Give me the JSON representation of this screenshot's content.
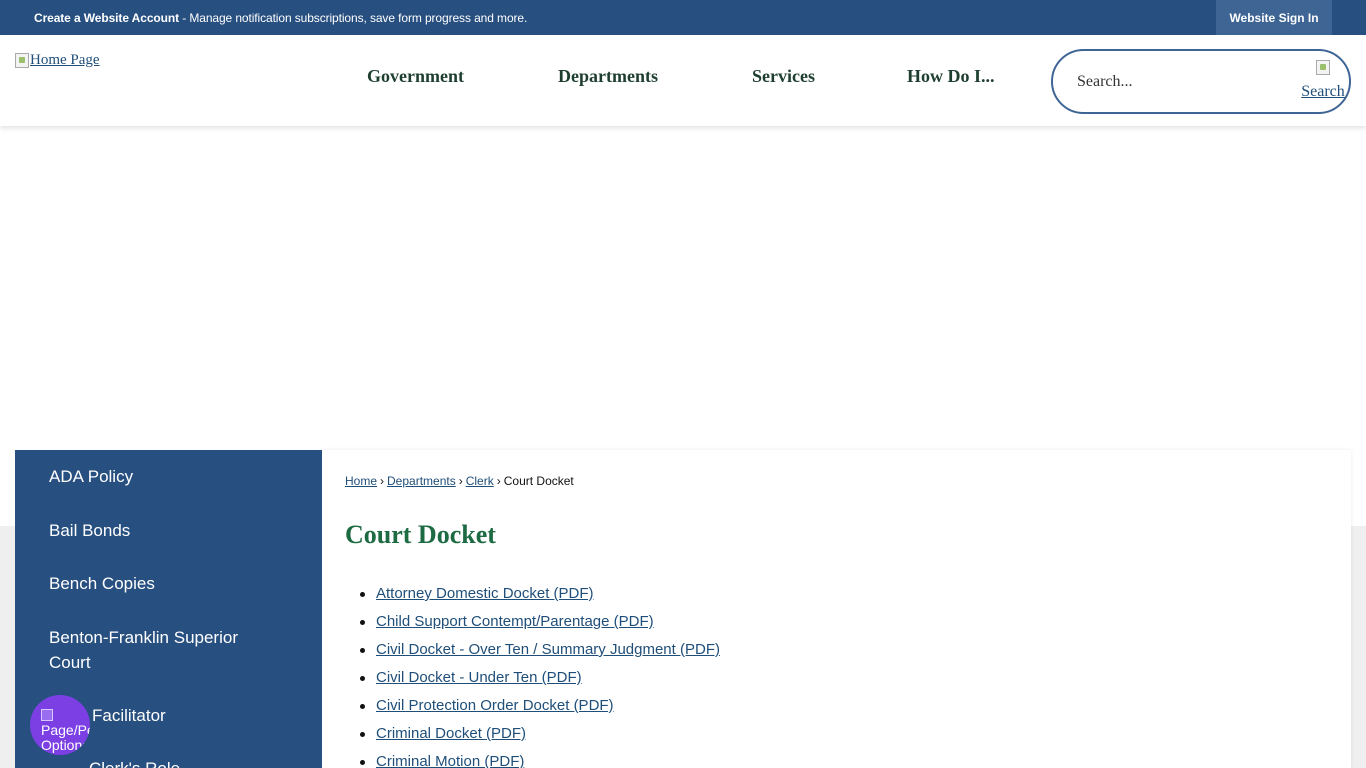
{
  "topbar": {
    "create_account_strong": "Create a Website Account",
    "create_account_rest": " - Manage notification subscriptions, save form progress and more.",
    "sign_in": "Website Sign In"
  },
  "header": {
    "logo_alt": "Home Page",
    "nav": [
      "Government",
      "Departments",
      "Services",
      "How Do I..."
    ],
    "search_placeholder": "Search...",
    "search_button_alt": "Search"
  },
  "sidebar": {
    "items": [
      "ADA Policy",
      "Bail Bonds",
      "Bench Copies",
      "Benton-Franklin Superior Court",
      "Facilitator",
      "Clerk's Role"
    ]
  },
  "breadcrumb": {
    "items": [
      "Home",
      "Departments",
      "Clerk"
    ],
    "current": "Court Docket",
    "separator": "›"
  },
  "page": {
    "title": "Court Docket",
    "documents": [
      "Attorney Domestic Docket (PDF)",
      "Child Support Contempt/Parentage (PDF)",
      "Civil Docket - Over Ten / Summary Judgment (PDF)",
      "Civil Docket - Under Ten (PDF)",
      "Civil Protection Order Docket (PDF)",
      "Criminal Docket (PDF)",
      "Criminal Motion (PDF)"
    ]
  },
  "badge": {
    "alt": "Page/Person Options"
  },
  "colors": {
    "primary_blue": "#274f80",
    "title_green": "#1d6b43",
    "badge_purple": "#7b3fe4"
  }
}
